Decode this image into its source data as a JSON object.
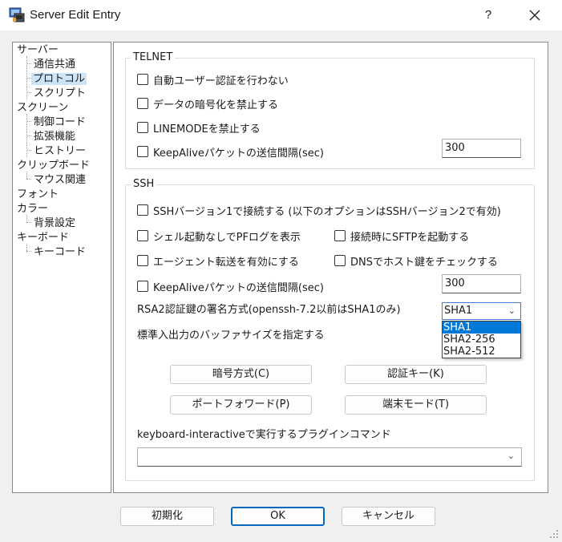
{
  "window": {
    "title": "Server Edit Entry",
    "help_label": "?",
    "close_label": "✕"
  },
  "tree": {
    "items": [
      {
        "label": "サーバー"
      },
      {
        "label": "通信共通"
      },
      {
        "label": "プロトコル",
        "selected": true
      },
      {
        "label": "スクリプト"
      },
      {
        "label": "スクリーン"
      },
      {
        "label": "制御コード"
      },
      {
        "label": "拡張機能"
      },
      {
        "label": "ヒストリー"
      },
      {
        "label": "クリップボード"
      },
      {
        "label": "マウス関連"
      },
      {
        "label": "フォント"
      },
      {
        "label": "カラー"
      },
      {
        "label": "背景設定"
      },
      {
        "label": "キーボード"
      },
      {
        "label": "キーコード"
      }
    ]
  },
  "telnet": {
    "title": "TELNET",
    "no_auto_auth": "自動ユーザー認証を行わない",
    "no_encryption": "データの暗号化を禁止する",
    "no_linemode": "LINEMODEを禁止する",
    "keepalive_label": "KeepAliveパケットの送信間隔(sec)",
    "keepalive_value": "300"
  },
  "ssh": {
    "title": "SSH",
    "ssh1": "SSHバージョン1で接続する (以下のオプションはSSHバージョン2で有効)",
    "pf_log": "シェル起動なしでPFログを表示",
    "sftp_on_connect": "接続時にSFTPを起動する",
    "agent_forward": "エージェント転送を有効にする",
    "dns_host_key": "DNSでホスト鍵をチェックする",
    "keepalive_label": "KeepAliveパケットの送信間隔(sec)",
    "keepalive_value": "300",
    "rsa_sig_label": "RSA2認証鍵の署名方式(openssh-7.2以前はSHA1のみ)",
    "rsa_sig_value": "SHA1",
    "rsa_sig_options": [
      "SHA1",
      "SHA2-256",
      "SHA2-512"
    ],
    "buffer_label": "標準入出力のバッファサイズを指定する",
    "btn_cipher": "暗号方式(C)",
    "btn_auth_key": "認証キー(K)",
    "btn_port_forward": "ポートフォワード(P)",
    "btn_terminal_mode": "端末モード(T)",
    "kbd_interactive_label": "keyboard-interactiveで実行するプラグインコマンド",
    "kbd_interactive_value": ""
  },
  "footer": {
    "reset": "初期化",
    "ok": "OK",
    "cancel": "キャンセル"
  },
  "colors": {
    "selection": "#cce4f7",
    "dropdown_highlight": "#0078d7",
    "ok_border": "#0067c0"
  }
}
